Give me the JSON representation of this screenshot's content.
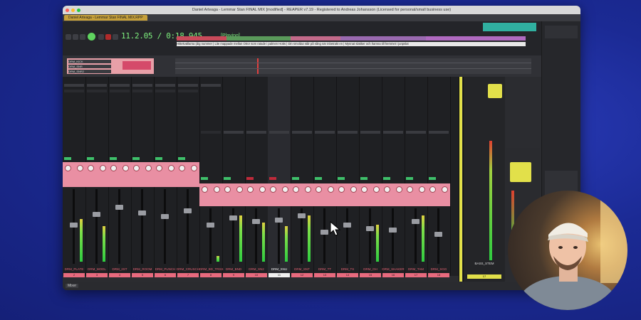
{
  "window": {
    "title": "Daniel Arteaga - Lemmar Stan FINAL MIX [modified] - REAPER v7.19 - Registered to Andreas Johansson (Licensed for personal/small business use)",
    "tab_label": "Daniel Arteaga - Lemmar Stan FINAL MIX.RPP"
  },
  "transport": {
    "timecode": "11.2.05 / 0:18.945",
    "status": "[Playing]"
  },
  "ruler": {
    "markers": [
      "8 VERS",
      "9 Chorus",
      "10",
      "11",
      "12",
      "13",
      "14 VERS 2"
    ]
  },
  "lyrics": "Hittekvällarna (dig nummer  | Lite mappade mellan Otror som ratade i palmen  Hotts | Din smoldut står på sång när inbetrakt en   | Mynnat slakker och hamna till hemmet i junpslat",
  "track_list": {
    "items": [
      "DRM_KICK",
      "DRM_SNR",
      "DRM_SNR2"
    ]
  },
  "mixer": {
    "tracks": [
      {
        "name": "DRM_PLATE",
        "num": "2"
      },
      {
        "name": "DRM_MODL",
        "num": "3"
      },
      {
        "name": "DRM_2ST",
        "num": "4"
      },
      {
        "name": "DRM_ROOM",
        "num": "5"
      },
      {
        "name": "DRM_PUNCH",
        "num": "6"
      },
      {
        "name": "DRM_CRUSCH",
        "num": "7"
      },
      {
        "name": "DRM_BD_TRSS",
        "num": "8"
      },
      {
        "name": "DRM_BND",
        "num": "9"
      },
      {
        "name": "DRM_SN2",
        "num": "10"
      },
      {
        "name": "DRM_SNU",
        "num": "11"
      },
      {
        "name": "DRM_SNT",
        "num": "12"
      },
      {
        "name": "DRM_TT",
        "num": "13"
      },
      {
        "name": "DRM_TS",
        "num": "14"
      },
      {
        "name": "DRM_OH",
        "num": "15"
      },
      {
        "name": "DRM_SHAKER",
        "num": "16"
      },
      {
        "name": "DRM_TAM",
        "num": "17"
      },
      {
        "name": "DRM_SGG",
        "num": "18"
      }
    ],
    "bus": {
      "name": "BASS_STEM",
      "num": "17"
    },
    "footer_label": "Mixer"
  },
  "colors": {
    "accent": "#e98fa3",
    "meter_green": "#2ecc40",
    "timecode": "#7ef07e"
  }
}
